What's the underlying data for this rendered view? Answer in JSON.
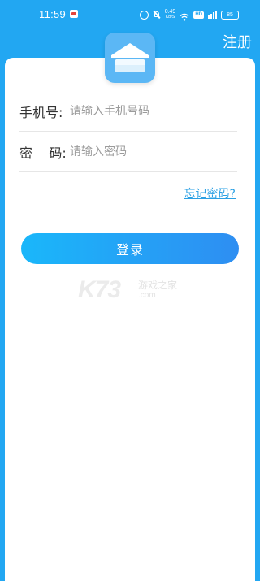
{
  "status_bar": {
    "time": "11:59",
    "net_speed_value": "0.49",
    "net_speed_unit": "KB/S",
    "network_badge": "HD",
    "battery": "85",
    "icons": [
      "notification-icon",
      "alarm-icon",
      "mute-icon",
      "wifi-icon",
      "signal-icon",
      "battery-icon"
    ]
  },
  "header": {
    "register_label": "注册"
  },
  "form": {
    "phone": {
      "label": "手机号:",
      "placeholder": "请输入手机号码",
      "value": ""
    },
    "password": {
      "label": "密    码:",
      "placeholder": "请输入密码",
      "value": ""
    },
    "forgot_password": "忘记密码?",
    "login_button": "登录"
  },
  "watermark": {
    "logo_text": "K73",
    "sub_text": "游戏之家",
    "domain": ".com"
  },
  "colors": {
    "background": "#22a7f2",
    "card": "#ffffff",
    "button_start": "#1ab7fa",
    "button_end": "#2e8ef2",
    "link": "#2aa0e4"
  }
}
